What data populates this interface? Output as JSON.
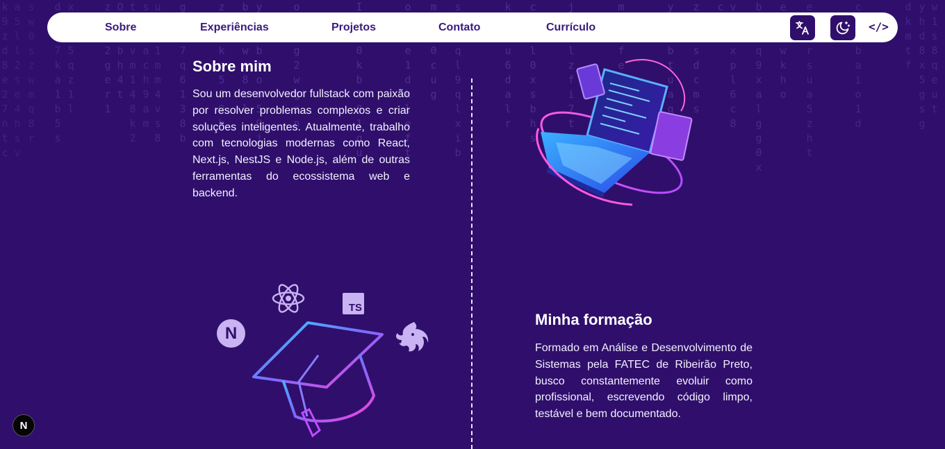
{
  "nav": {
    "items": [
      {
        "label": "Sobre"
      },
      {
        "label": "Experiências"
      },
      {
        "label": "Projetos"
      },
      {
        "label": "Contato"
      },
      {
        "label": "Currículo"
      }
    ],
    "translate_icon": "translate-icon",
    "theme_icon": "moon-icon",
    "code_label": "</>"
  },
  "about": {
    "title": "Sobre mim",
    "text": "Sou um desenvolvedor fullstack com paixão por resolver problemas complexos e criar soluções inteligentes. Atualmente, trabalho com tecnologias modernas como React, Next.js, NestJS e Node.js, além de outras ferramentas do ecossistema web e backend."
  },
  "education": {
    "title": "Minha formação",
    "text": "Formado em Análise e Desenvolvimento de Sistemas pela FATEC de Ribeirão Preto, busco constantemente evoluir como profissional, escrevendo código limpo, testável e bem documentado."
  },
  "tech_icons": {
    "ts_label": "TS",
    "next_letter": "N"
  },
  "next_badge": "N",
  "colors": {
    "background": "#2f0f6b",
    "nav_text": "#3a1a7e",
    "icon_lilac": "#c9b3f2"
  }
}
